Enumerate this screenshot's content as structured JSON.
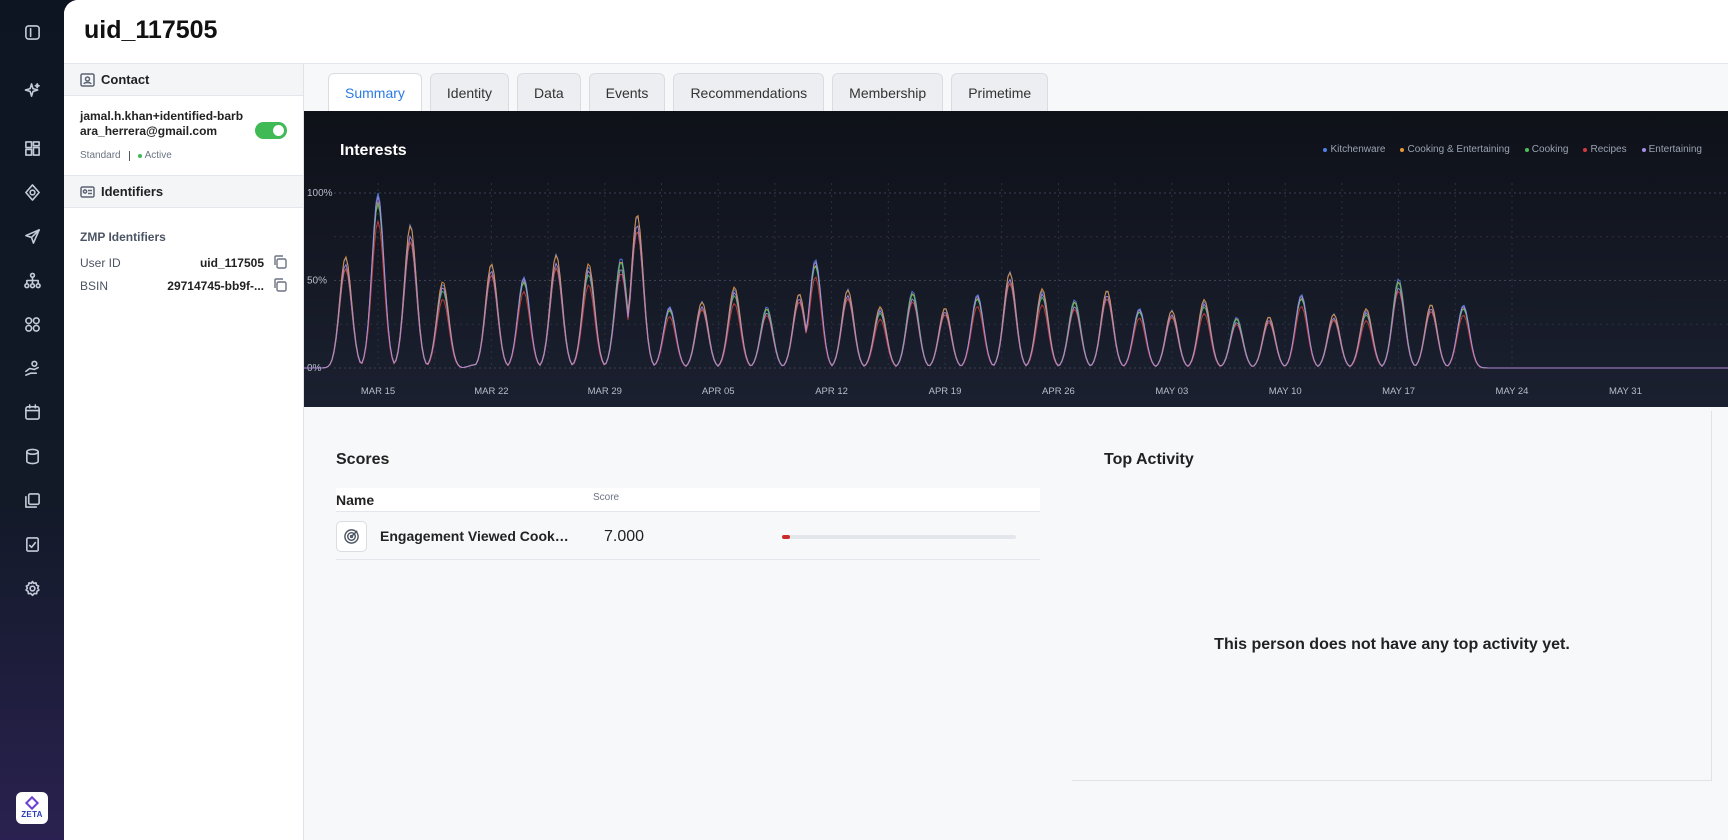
{
  "page": {
    "title": "uid_117505"
  },
  "nav": {
    "icons": [
      "sidebar-toggle-icon",
      "sparkle-icon",
      "dashboard-icon",
      "target-icon",
      "send-icon",
      "hierarchy-icon",
      "audiences-icon",
      "hand-money-icon",
      "calendar-icon",
      "database-icon",
      "library-icon",
      "report-icon",
      "settings-icon"
    ],
    "logo_text": "ZETA"
  },
  "contact": {
    "section_label": "Contact",
    "email": "jamal.h.khan+identified-barbara_herrera@gmail.com",
    "plan": "Standard",
    "status": "Active",
    "enabled": true
  },
  "identifiers": {
    "section_label": "Identifiers",
    "group_label": "ZMP Identifiers",
    "items": [
      {
        "key": "User ID",
        "value": "uid_117505"
      },
      {
        "key": "BSIN",
        "value": "29714745-bb9f-..."
      }
    ]
  },
  "tabs": [
    "Summary",
    "Identity",
    "Data",
    "Events",
    "Recommendations",
    "Membership",
    "Primetime"
  ],
  "active_tab": "Summary",
  "chart_data": {
    "type": "area",
    "title": "Interests",
    "y_ticks": [
      "100%",
      "50%",
      "0%"
    ],
    "ylim": [
      0,
      100
    ],
    "x_ticks": [
      "MAR 15",
      "MAR 22",
      "MAR 29",
      "APR 05",
      "APR 12",
      "APR 19",
      "APR 26",
      "MAY 03",
      "MAY 10",
      "MAY 17",
      "MAY 24",
      "MAY 31"
    ],
    "grid": true,
    "legend_position": "top-right",
    "series": [
      {
        "name": "Kitchenware",
        "color": "#4f7fe8",
        "peak_scale": 1.0
      },
      {
        "name": "Cooking & Entertaining",
        "color": "#e8963a",
        "peak_scale": 0.95
      },
      {
        "name": "Cooking",
        "color": "#4fbf5a",
        "peak_scale": 0.88
      },
      {
        "name": "Recipes",
        "color": "#d63a3a",
        "peak_scale": 0.82
      },
      {
        "name": "Entertaining",
        "color": "#a88ee8",
        "peak_scale": 0.9
      }
    ],
    "peaks": [
      {
        "day": 1,
        "value": 63
      },
      {
        "day": 3,
        "value": 100
      },
      {
        "day": 5,
        "value": 82
      },
      {
        "day": 7,
        "value": 48
      },
      {
        "day": 9,
        "value": 2
      },
      {
        "day": 10,
        "value": 59
      },
      {
        "day": 12,
        "value": 52
      },
      {
        "day": 14,
        "value": 65
      },
      {
        "day": 16,
        "value": 58
      },
      {
        "day": 18,
        "value": 63
      },
      {
        "day": 19,
        "value": 87
      },
      {
        "day": 21,
        "value": 35
      },
      {
        "day": 23,
        "value": 38
      },
      {
        "day": 25,
        "value": 45
      },
      {
        "day": 27,
        "value": 35
      },
      {
        "day": 29,
        "value": 42
      },
      {
        "day": 30,
        "value": 62
      },
      {
        "day": 32,
        "value": 45
      },
      {
        "day": 34,
        "value": 34
      },
      {
        "day": 36,
        "value": 44
      },
      {
        "day": 38,
        "value": 34
      },
      {
        "day": 40,
        "value": 42
      },
      {
        "day": 42,
        "value": 55
      },
      {
        "day": 44,
        "value": 44
      },
      {
        "day": 46,
        "value": 39
      },
      {
        "day": 48,
        "value": 44
      },
      {
        "day": 50,
        "value": 34
      },
      {
        "day": 52,
        "value": 33
      },
      {
        "day": 54,
        "value": 38
      },
      {
        "day": 56,
        "value": 29
      },
      {
        "day": 58,
        "value": 29
      },
      {
        "day": 60,
        "value": 42
      },
      {
        "day": 62,
        "value": 31
      },
      {
        "day": 64,
        "value": 33
      },
      {
        "day": 66,
        "value": 51
      },
      {
        "day": 68,
        "value": 36
      },
      {
        "day": 70,
        "value": 36
      }
    ],
    "x_start": "MAR 12"
  },
  "scores": {
    "title": "Scores",
    "col_name": "Name",
    "col_score": "Score",
    "rows": [
      {
        "name": "Engagement Viewed Cookwa...",
        "score": "7.000",
        "fraction": 0.035
      }
    ]
  },
  "top_activity": {
    "title": "Top Activity",
    "empty_message": "This person does not have any top activity yet."
  }
}
